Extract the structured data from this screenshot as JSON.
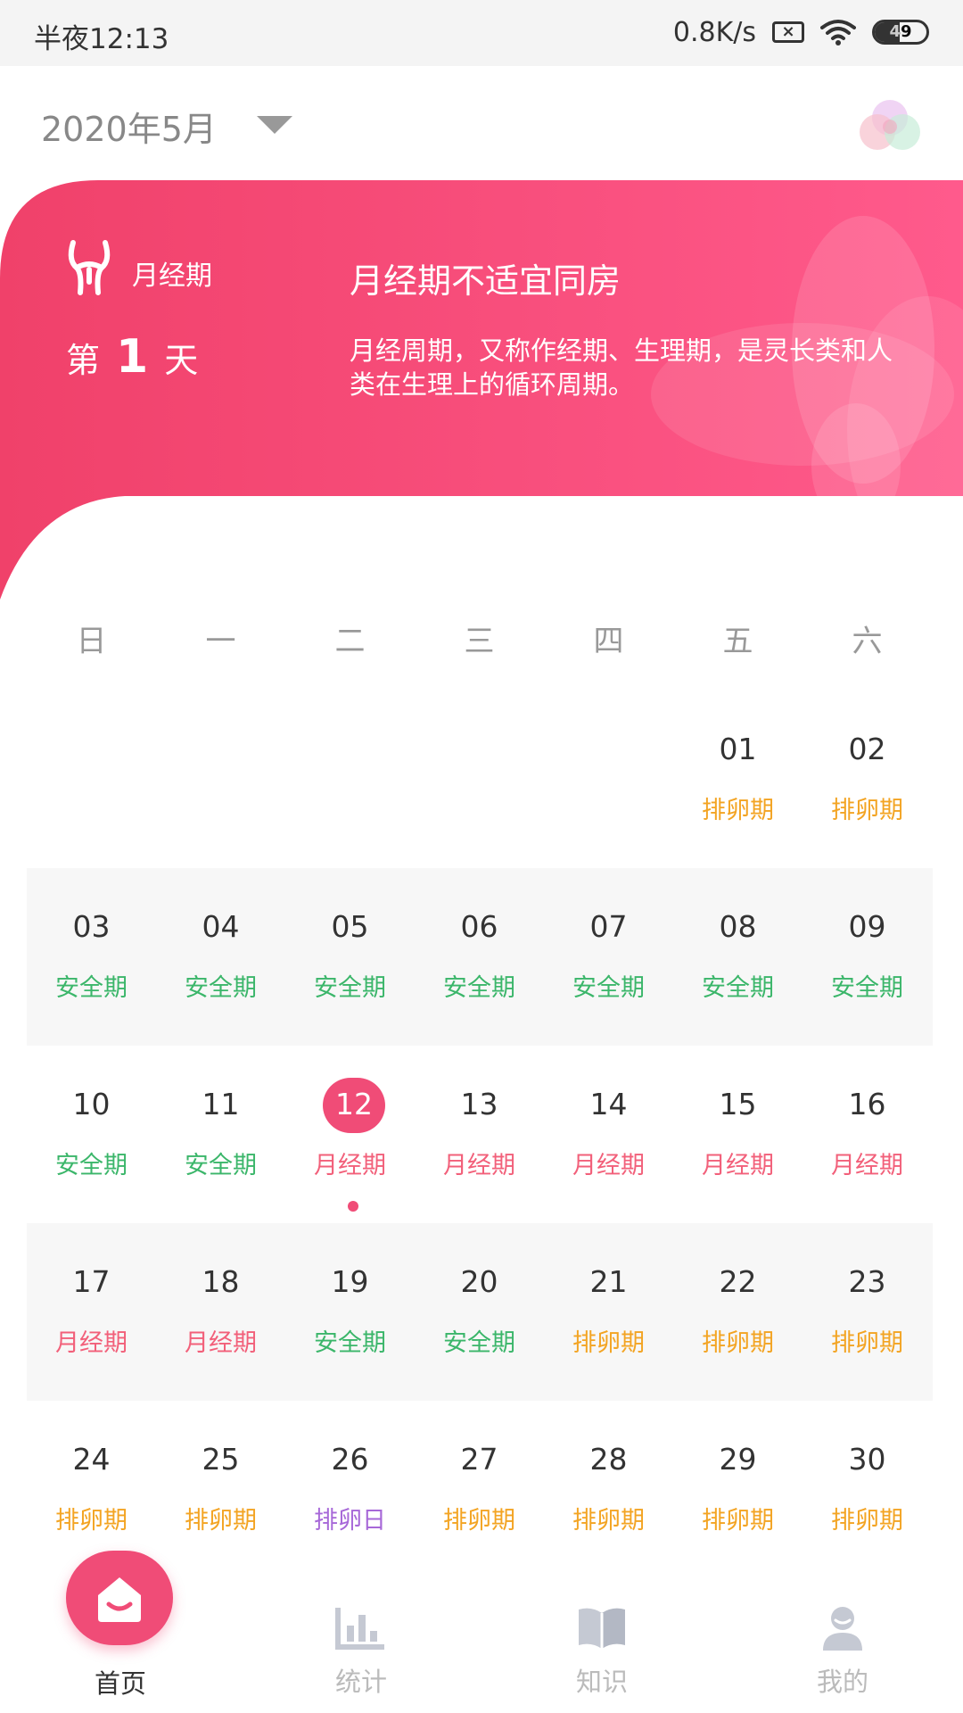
{
  "status_bar": {
    "time": "半夜12:13",
    "network_speed": "0.8K/s",
    "battery": "49",
    "battery_level_percent": 49,
    "icons": [
      "sim-disabled-icon",
      "wifi-icon",
      "battery-icon"
    ]
  },
  "header": {
    "month": "2020年5月",
    "dropdown_icon": "caret-down-icon",
    "avatar_icon": "color-blob-icon"
  },
  "banner": {
    "icon": "uterus-icon",
    "phase_label": "月经期",
    "day_prefix": "第",
    "day_number": "1",
    "day_suffix": "天",
    "title": "月经期不适宜同房",
    "description": "月经周期，又称作经期、生理期，是灵长类和人类在生理上的循环周期。",
    "colors": {
      "start": "#f0416a",
      "end": "#ff5a8c"
    }
  },
  "weekdays": [
    "日",
    "一",
    "二",
    "三",
    "四",
    "五",
    "六"
  ],
  "calendar": {
    "weeks": [
      [
        {
          "day": "",
          "status": "",
          "type": ""
        },
        {
          "day": "",
          "status": "",
          "type": ""
        },
        {
          "day": "",
          "status": "",
          "type": ""
        },
        {
          "day": "",
          "status": "",
          "type": ""
        },
        {
          "day": "",
          "status": "",
          "type": ""
        },
        {
          "day": "01",
          "status": "排卵期",
          "type": "fertile"
        },
        {
          "day": "02",
          "status": "排卵期",
          "type": "fertile"
        }
      ],
      [
        {
          "day": "03",
          "status": "安全期",
          "type": "safe"
        },
        {
          "day": "04",
          "status": "安全期",
          "type": "safe"
        },
        {
          "day": "05",
          "status": "安全期",
          "type": "safe"
        },
        {
          "day": "06",
          "status": "安全期",
          "type": "safe"
        },
        {
          "day": "07",
          "status": "安全期",
          "type": "safe"
        },
        {
          "day": "08",
          "status": "安全期",
          "type": "safe"
        },
        {
          "day": "09",
          "status": "安全期",
          "type": "safe"
        }
      ],
      [
        {
          "day": "10",
          "status": "安全期",
          "type": "safe"
        },
        {
          "day": "11",
          "status": "安全期",
          "type": "safe"
        },
        {
          "day": "12",
          "status": "月经期",
          "type": "period",
          "today": true
        },
        {
          "day": "13",
          "status": "月经期",
          "type": "period"
        },
        {
          "day": "14",
          "status": "月经期",
          "type": "period"
        },
        {
          "day": "15",
          "status": "月经期",
          "type": "period"
        },
        {
          "day": "16",
          "status": "月经期",
          "type": "period"
        }
      ],
      [
        {
          "day": "17",
          "status": "月经期",
          "type": "period"
        },
        {
          "day": "18",
          "status": "月经期",
          "type": "period"
        },
        {
          "day": "19",
          "status": "安全期",
          "type": "safe"
        },
        {
          "day": "20",
          "status": "安全期",
          "type": "safe"
        },
        {
          "day": "21",
          "status": "排卵期",
          "type": "fertile"
        },
        {
          "day": "22",
          "status": "排卵期",
          "type": "fertile"
        },
        {
          "day": "23",
          "status": "排卵期",
          "type": "fertile"
        }
      ],
      [
        {
          "day": "24",
          "status": "排卵期",
          "type": "fertile"
        },
        {
          "day": "25",
          "status": "排卵期",
          "type": "fertile"
        },
        {
          "day": "26",
          "status": "排卵日",
          "type": "ovulation"
        },
        {
          "day": "27",
          "status": "排卵期",
          "type": "fertile"
        },
        {
          "day": "28",
          "status": "排卵期",
          "type": "fertile"
        },
        {
          "day": "29",
          "status": "排卵期",
          "type": "fertile"
        },
        {
          "day": "30",
          "status": "排卵期",
          "type": "fertile"
        }
      ]
    ],
    "status_colors": {
      "safe": "#3bb66a",
      "period": "#f2607a",
      "fertile": "#f3a423",
      "ovulation": "#a768d8",
      "today": "#f04c77"
    }
  },
  "tabbar": {
    "tabs": [
      {
        "label": "首页",
        "icon": "home-icon",
        "active": true
      },
      {
        "label": "统计",
        "icon": "bar-chart-icon",
        "active": false
      },
      {
        "label": "知识",
        "icon": "book-icon",
        "active": false
      },
      {
        "label": "我的",
        "icon": "user-icon",
        "active": false
      }
    ]
  }
}
